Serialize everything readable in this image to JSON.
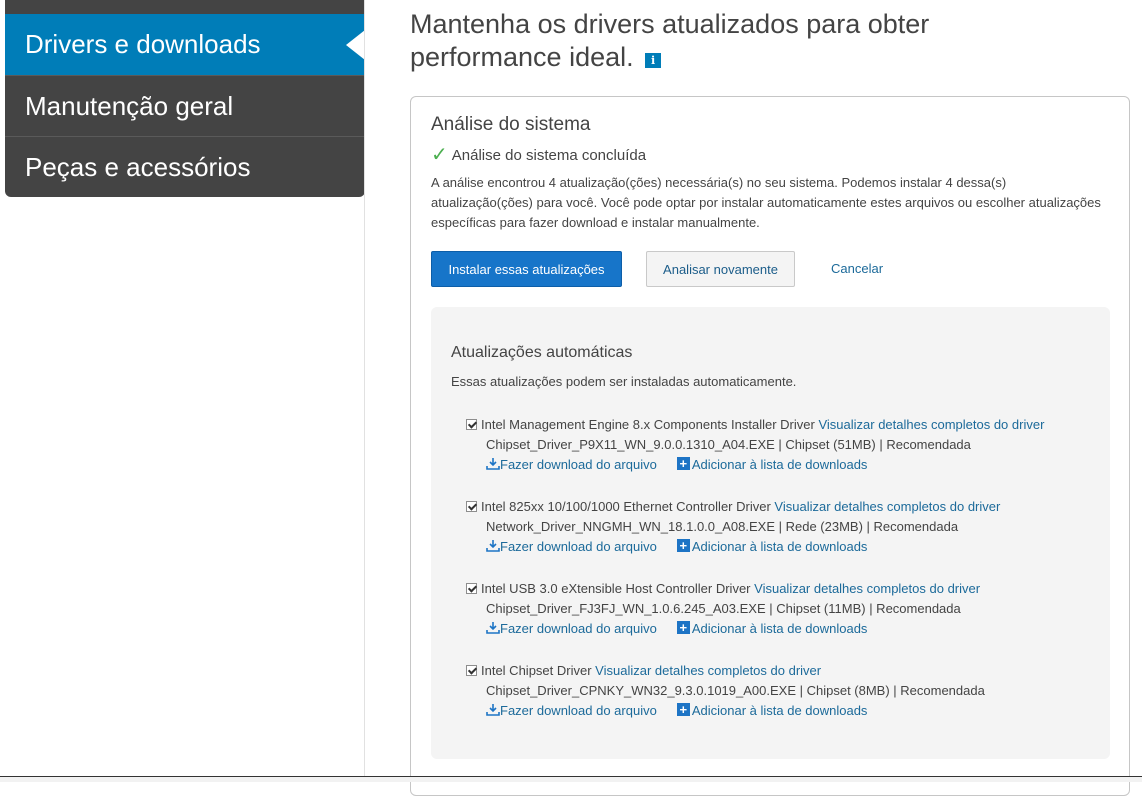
{
  "sidebar": {
    "items": [
      {
        "label": "Drivers e downloads",
        "active": true
      },
      {
        "label": "Manutenção geral",
        "active": false
      },
      {
        "label": "Peças e acessórios",
        "active": false
      }
    ]
  },
  "header": {
    "title": "Mantenha os drivers atualizados para obter performance ideal.",
    "info_icon_glyph": "i"
  },
  "analysis": {
    "title": "Análise do sistema",
    "status": "Análise do sistema concluída",
    "description": "A análise encontrou 4 atualização(ções) necessária(s) no seu sistema. Podemos instalar 4 dessa(s) atualização(ções) para você. Você pode optar por instalar automaticamente estes arquivos ou escolher atualizações específicas para fazer download e instalar manualmente.",
    "buttons": {
      "install": "Instalar essas atualizações",
      "rescan": "Analisar novamente",
      "cancel": "Cancelar"
    }
  },
  "auto_updates": {
    "title": "Atualizações automáticas",
    "subtitle": "Essas atualizações podem ser instaladas automaticamente.",
    "download_label": "Fazer download do arquivo",
    "add_list_label": "Adicionar à lista de downloads",
    "details_label": "Visualizar detalhes completos do driver",
    "drivers": [
      {
        "name": "Intel Management Engine 8.x Components Installer Driver",
        "file": "Chipset_Driver_P9X11_WN_9.0.0.1310_A04.EXE | Chipset (51MB) | Recomendada",
        "checked": true
      },
      {
        "name": "Intel 825xx 10/100/1000 Ethernet Controller Driver",
        "file": "Network_Driver_NNGMH_WN_18.1.0.0_A08.EXE | Rede (23MB) | Recomendada",
        "checked": true
      },
      {
        "name": "Intel USB 3.0 eXtensible Host Controller Driver",
        "file": "Chipset_Driver_FJ3FJ_WN_1.0.6.245_A03.EXE | Chipset (11MB) | Recomendada",
        "checked": true
      },
      {
        "name": "Intel Chipset Driver",
        "file": "Chipset_Driver_CPNKY_WN32_9.3.0.1019_A00.EXE | Chipset (8MB) | Recomendada",
        "checked": true
      }
    ]
  },
  "colors": {
    "sidebar_bg": "#444444",
    "accent": "#007db8",
    "primary_button": "#1775c9",
    "link": "#1c6a9a",
    "success": "#4caf50"
  },
  "icons": {
    "check": "check-icon",
    "download": "download-icon",
    "add": "plus-box-icon",
    "info": "info-icon"
  }
}
